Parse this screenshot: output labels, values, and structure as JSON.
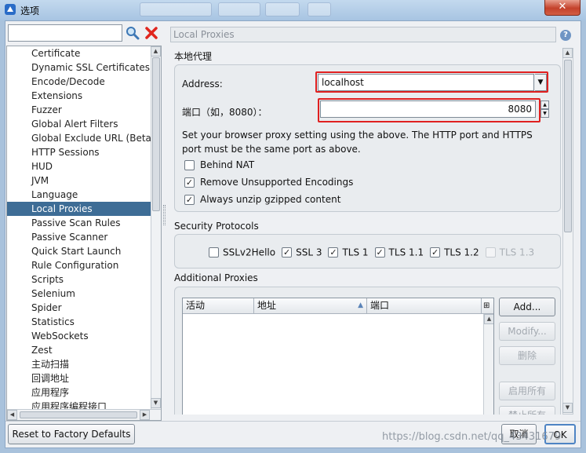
{
  "window": {
    "title": "选项",
    "close_symbol": "✕"
  },
  "search": {
    "value": "",
    "placeholder": ""
  },
  "tree": {
    "items": [
      {
        "label": "Certificate",
        "selected": false
      },
      {
        "label": "Dynamic SSL Certificates",
        "selected": false
      },
      {
        "label": "Encode/Decode",
        "selected": false
      },
      {
        "label": "Extensions",
        "selected": false
      },
      {
        "label": "Fuzzer",
        "selected": false
      },
      {
        "label": "Global Alert Filters",
        "selected": false
      },
      {
        "label": "Global Exclude URL (Beta)",
        "selected": false
      },
      {
        "label": "HTTP Sessions",
        "selected": false
      },
      {
        "label": "HUD",
        "selected": false
      },
      {
        "label": "JVM",
        "selected": false
      },
      {
        "label": "Language",
        "selected": false
      },
      {
        "label": "Local Proxies",
        "selected": true
      },
      {
        "label": "Passive Scan Rules",
        "selected": false
      },
      {
        "label": "Passive Scanner",
        "selected": false
      },
      {
        "label": "Quick Start Launch",
        "selected": false
      },
      {
        "label": "Rule Configuration",
        "selected": false
      },
      {
        "label": "Scripts",
        "selected": false
      },
      {
        "label": "Selenium",
        "selected": false
      },
      {
        "label": "Spider",
        "selected": false
      },
      {
        "label": "Statistics",
        "selected": false
      },
      {
        "label": "WebSockets",
        "selected": false
      },
      {
        "label": "Zest",
        "selected": false
      },
      {
        "label": "主动扫描",
        "selected": false
      },
      {
        "label": "回调地址",
        "selected": false
      },
      {
        "label": "应用程序",
        "selected": false
      },
      {
        "label": "应用程序编程接口",
        "selected": false
      }
    ]
  },
  "panel": {
    "title": "Local Proxies",
    "local_proxy": {
      "section_label": "本地代理",
      "address_label": "Address:",
      "address_value": "localhost",
      "port_label": "端口（如，8080）：",
      "port_value": "8080",
      "description": "Set your browser proxy setting using the above.  The HTTP port and HTTPS port must be the same port as above.",
      "options": [
        {
          "label": "Behind NAT",
          "checked": false
        },
        {
          "label": "Remove Unsupported Encodings",
          "checked": true
        },
        {
          "label": "Always unzip gzipped content",
          "checked": true
        }
      ]
    },
    "security": {
      "section_label": "Security Protocols",
      "protocols": [
        {
          "label": "SSLv2Hello",
          "checked": false,
          "enabled": true
        },
        {
          "label": "SSL 3",
          "checked": true,
          "enabled": true
        },
        {
          "label": "TLS 1",
          "checked": true,
          "enabled": true
        },
        {
          "label": "TLS 1.1",
          "checked": true,
          "enabled": true
        },
        {
          "label": "TLS 1.2",
          "checked": true,
          "enabled": true
        },
        {
          "label": "TLS 1.3",
          "checked": false,
          "enabled": false
        }
      ]
    },
    "additional": {
      "section_label": "Additional Proxies",
      "columns": [
        "活动",
        "地址",
        "端口"
      ],
      "buttons": {
        "add": "Add...",
        "modify": "Modify...",
        "remove": "删除",
        "enable_all": "启用所有",
        "disable_all": "禁止所有"
      }
    }
  },
  "footer": {
    "reset": "Reset to Factory Defaults",
    "cancel": "取消",
    "ok": "OK",
    "watermark": "https://blog.csdn.net/qq_43431679"
  },
  "colors": {
    "selection": "#3e6d96",
    "highlight_frame": "#e02020"
  }
}
